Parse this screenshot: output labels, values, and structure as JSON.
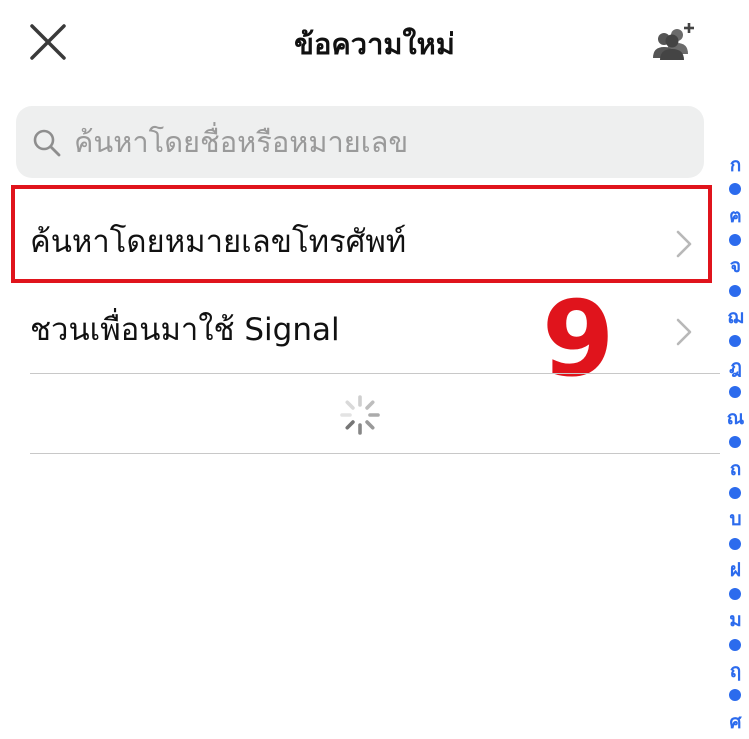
{
  "header": {
    "title": "ข้อความใหม่",
    "close_icon": "close-icon",
    "group_icon": "new-group-icon"
  },
  "search": {
    "placeholder": "ค้นหาโดยชื่อหรือหมายเลข",
    "value": "",
    "icon": "search-icon"
  },
  "rows": [
    {
      "label": "ค้นหาโดยหมายเลขโทรศัพท์",
      "icon": "chevron-right-icon"
    },
    {
      "label": "ชวนเพื่อนมาใช้ Signal",
      "icon": "chevron-right-icon"
    }
  ],
  "annotation": {
    "number": "9",
    "color": "#e0141c"
  },
  "index_bar": {
    "color": "#2c6bed",
    "letters": [
      "ก",
      "ฅ",
      "จ",
      "ฌ",
      "ฎ",
      "ณ",
      "ถ",
      "บ",
      "ฝ",
      "ม",
      "ฤ",
      "ศ"
    ]
  },
  "colors": {
    "accent": "#2c6bed",
    "search_bg": "#eeefef",
    "highlight": "#e0141c"
  }
}
